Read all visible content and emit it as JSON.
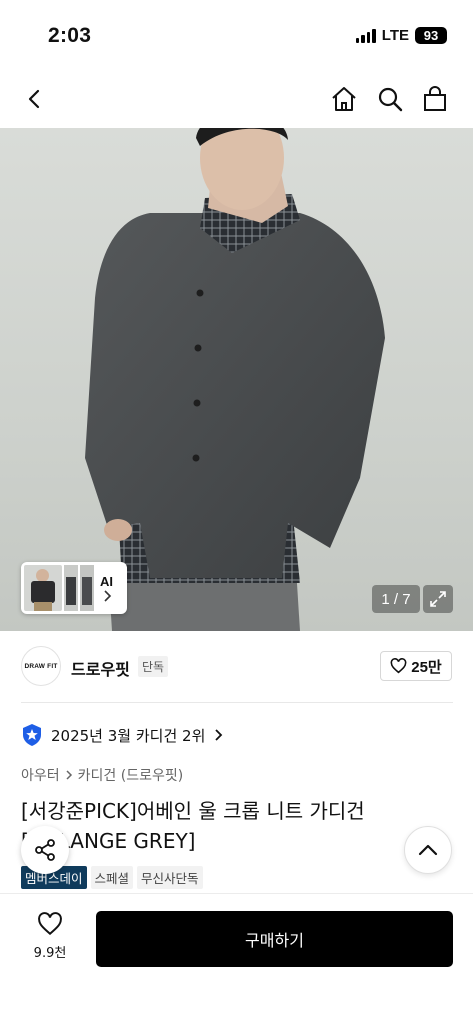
{
  "status_bar": {
    "time": "2:03",
    "network": "LTE",
    "battery": "93"
  },
  "nav": {
    "icons": [
      "back-icon",
      "home-icon",
      "search-icon",
      "shopping-bag-icon"
    ]
  },
  "gallery": {
    "ai_label": "AI",
    "page_counter": "1 / 7"
  },
  "brand": {
    "logo_text": "DRAW FIT",
    "name": "드로우핏",
    "badge": "단독",
    "like_count": "25만"
  },
  "ranking": {
    "text": "2025년 3월 카디건 2위"
  },
  "category": {
    "parent": "아우터",
    "child": "카디건 (드로우핏)"
  },
  "product": {
    "title": "[서강준PICK]어베인 울 크롭 니트 가디건 [MELANGE GREY]"
  },
  "tags": [
    "멤버스데이",
    "스페셜",
    "무신사단독"
  ],
  "bottom_bar": {
    "wish_count": "9.9천",
    "buy_label": "구매하기"
  },
  "colors": {
    "primary": "#000000",
    "tag_dark": "#0f3b5c",
    "rank_badge": "#1e5ee6"
  }
}
